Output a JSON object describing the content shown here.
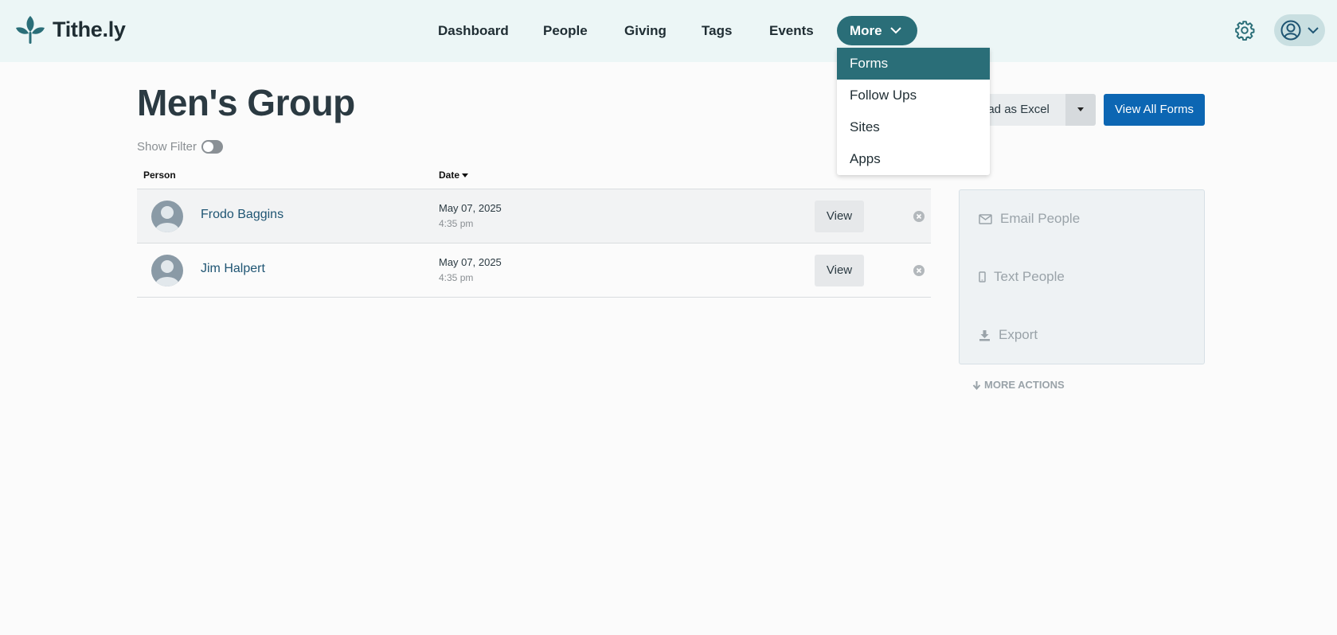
{
  "brand": {
    "name": "Tithe.ly"
  },
  "nav": {
    "items": [
      "Dashboard",
      "People",
      "Giving",
      "Tags",
      "Events"
    ],
    "more_label": "More"
  },
  "dropdown": {
    "items": [
      "Forms",
      "Follow Ups",
      "Sites",
      "Apps"
    ],
    "active": "Forms"
  },
  "page": {
    "title": "Men's Group",
    "show_filter_label": "Show Filter",
    "download_label": "oad as Excel",
    "view_all_label": "View All Forms"
  },
  "table": {
    "headers": {
      "person": "Person",
      "date": "Date"
    },
    "rows": [
      {
        "name": "Frodo Baggins",
        "date": "May 07, 2025",
        "time": "4:35 pm",
        "action": "View"
      },
      {
        "name": "Jim Halpert",
        "date": "May 07, 2025",
        "time": "4:35 pm",
        "action": "View"
      }
    ]
  },
  "actions": {
    "items": [
      "Email People",
      "Text People",
      "Export"
    ],
    "more_label": "MORE ACTIONS"
  },
  "colors": {
    "accent": "#2a6e78",
    "primary_button": "#0c66b3",
    "nav_bg": "#ecf6f6"
  },
  "icons": {
    "logo": "leaf-logo-icon",
    "settings": "gear-icon",
    "account": "user-circle-icon",
    "email": "envelope-icon",
    "text": "mobile-phone-icon",
    "export": "download-icon",
    "remove": "close-circle-icon",
    "more": "arrow-down-icon"
  }
}
